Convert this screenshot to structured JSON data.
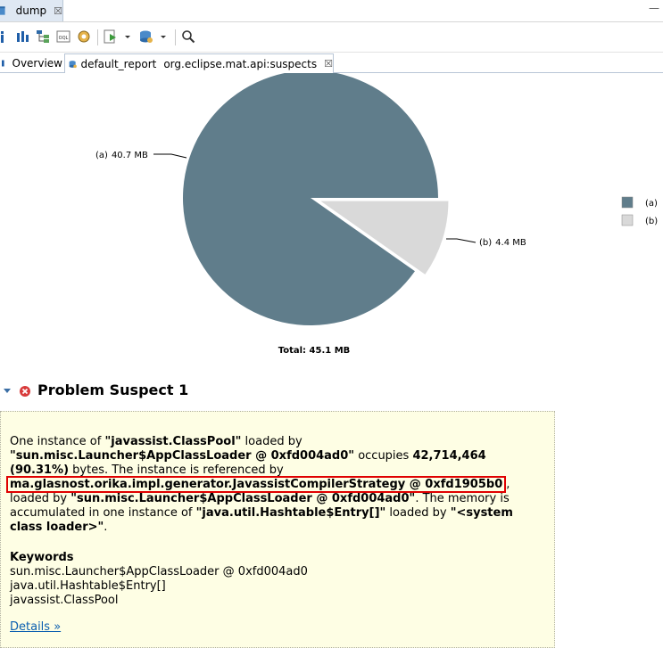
{
  "editor_tab": {
    "label": "dump",
    "close": "☒"
  },
  "window": {
    "minimize": "—"
  },
  "toolbar": {
    "icons": [
      "info-icon",
      "histogram-icon",
      "dominator-tree-icon",
      "oql-icon",
      "heap-dump-overview-icon",
      "run-report-icon",
      "dropdown-arrow-icon",
      "query-browser-icon",
      "dropdown-arrow-icon",
      "search-icon"
    ]
  },
  "report_tabs": {
    "overview": "Overview",
    "active_name": "default_report",
    "active_id": "org.eclipse.mat.api:suspects",
    "close": "☒"
  },
  "chart_data": {
    "type": "pie",
    "slices": [
      {
        "label": "(a)",
        "value": 40.7,
        "display": "40.7 MB",
        "color": "#607d8b"
      },
      {
        "label": "(b)",
        "value": 4.4,
        "display": "4.4 MB",
        "color": "#d9d9d9"
      }
    ],
    "total_label": "Total: 45.1 MB",
    "legend": [
      "(a)",
      "(b)"
    ],
    "legend_position": "right"
  },
  "suspect": {
    "title": "Problem Suspect 1",
    "p1_a": "One instance of ",
    "p1_b": "\"javassist.ClassPool\"",
    "p1_c": " loaded by",
    "p2_a": "\"sun.misc.Launcher$AppClassLoader @ 0xfd004ad0\"",
    "p2_b": " occupies ",
    "p2_c": "42,714,464",
    "p3_a": "(90.31%)",
    "p3_b": " bytes. The instance is referenced by",
    "p4": "ma.glasnost.orika.impl.generator.JavassistCompilerStrategy @ 0xfd1905b0",
    "p4_tail": ",",
    "p5_a": "loaded by ",
    "p5_b": "\"sun.misc.Launcher$AppClassLoader @ 0xfd004ad0\"",
    "p5_c": ". The memory is",
    "p6_a": "accumulated in one instance of ",
    "p6_b": "\"java.util.Hashtable$Entry[]\"",
    "p6_c": " loaded by ",
    "p6_d": "\"<system",
    "p7_a": "class loader>\"",
    "p7_b": ".",
    "keywords_title": "Keywords",
    "keywords": [
      "sun.misc.Launcher$AppClassLoader @ 0xfd004ad0",
      "java.util.Hashtable$Entry[]",
      "javassist.ClassPool"
    ],
    "details_link": "Details »"
  }
}
